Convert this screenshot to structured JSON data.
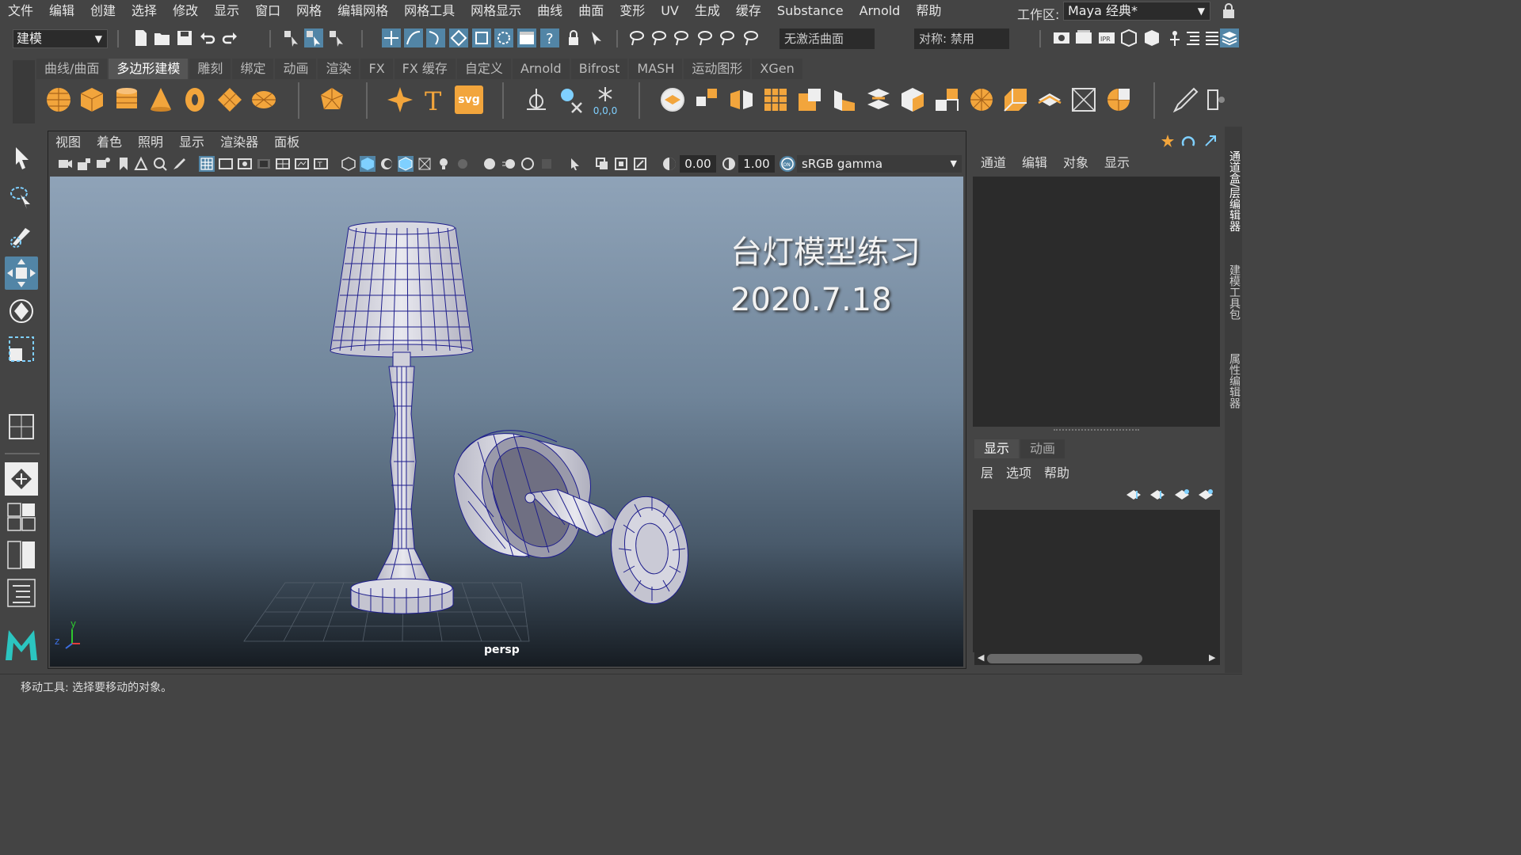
{
  "menubar": {
    "items": [
      "文件",
      "编辑",
      "创建",
      "选择",
      "修改",
      "显示",
      "窗口",
      "网格",
      "编辑网格",
      "网格工具",
      "网格显示",
      "曲线",
      "曲面",
      "变形",
      "UV",
      "生成",
      "缓存",
      "Substance",
      "Arnold",
      "帮助"
    ],
    "workspace_label": "工作区:",
    "workspace_value": "Maya 经典*"
  },
  "statusline": {
    "menuset": "建模",
    "live_surface": "无激活曲面",
    "symmetry": "对称: 禁用"
  },
  "shelf": {
    "tabs": [
      "曲线/曲面",
      "多边形建模",
      "雕刻",
      "绑定",
      "动画",
      "渲染",
      "FX",
      "FX 缓存",
      "自定义",
      "Arnold",
      "Bifrost",
      "MASH",
      "运动图形",
      "XGen"
    ],
    "active_tab": "多边形建模",
    "svg_label": "svg",
    "xyz_label": "0,0,0"
  },
  "panel": {
    "menu": [
      "视图",
      "着色",
      "照明",
      "显示",
      "渲染器",
      "面板"
    ],
    "exposure": "0.00",
    "gamma": "1.00",
    "color_space": "sRGB gamma",
    "camera": "persp",
    "overlay_title": "台灯模型练习",
    "overlay_date": "2020.7.18",
    "axis_y": "y",
    "axis_z": "z"
  },
  "channel_box": {
    "menu": [
      "通道",
      "编辑",
      "对象",
      "显示"
    ]
  },
  "layer_editor": {
    "tabs": [
      "显示",
      "动画"
    ],
    "active_tab": "显示",
    "menu": [
      "层",
      "选项",
      "帮助"
    ]
  },
  "side_tabs": [
    "通道盒/层编辑器",
    "建模工具包",
    "属性编辑器"
  ],
  "helpline": {
    "text": "移动工具: 选择要移动的对象。"
  },
  "colors": {
    "accent": "#5285a6",
    "shelf_orange": "#f2a53c",
    "wire": "#1e1e8c"
  }
}
